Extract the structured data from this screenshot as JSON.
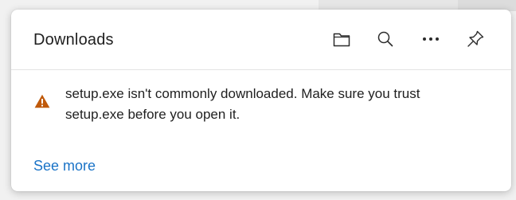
{
  "downloads_panel": {
    "title": "Downloads",
    "toolbar": {
      "open_folder_icon": "folder-icon",
      "search_icon": "search-icon",
      "more_icon": "more-options-icon",
      "pin_icon": "pin-icon"
    },
    "warning": {
      "icon": "warning-triangle-icon",
      "icon_color": "#c05a0b",
      "message": "setup.exe isn't commonly downloaded. Make sure you trust setup.exe before you open it."
    },
    "see_more_label": "See more",
    "link_color": "#1a73c7"
  }
}
